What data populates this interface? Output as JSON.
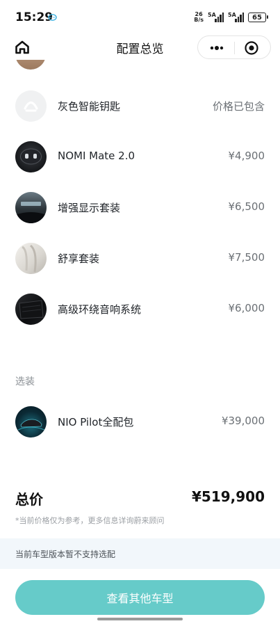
{
  "status_bar": {
    "time": "15:29",
    "net_speed_value": "26",
    "net_speed_unit": "B/s",
    "signal_1_label": "5A",
    "signal_2_label": "5A",
    "battery": "65"
  },
  "nav": {
    "title": "配置总览"
  },
  "items": [
    {
      "name": "灰色智能钥匙",
      "price": "价格已包含",
      "icon": "nio-key-icon"
    },
    {
      "name": "NOMI Mate 2.0",
      "price": "¥4,900",
      "icon": "nomi-mate-icon"
    },
    {
      "name": "增强显示套装",
      "price": "¥6,500",
      "icon": "display-package-icon"
    },
    {
      "name": "舒享套装",
      "price": "¥7,500",
      "icon": "comfort-package-icon"
    },
    {
      "name": "高级环绕音响系统",
      "price": "¥6,000",
      "icon": "audio-system-icon"
    }
  ],
  "optional_section": {
    "label": "选装",
    "items": [
      {
        "name": "NIO Pilot全配包",
        "price": "¥39,000",
        "icon": "nio-pilot-icon"
      }
    ]
  },
  "summary": {
    "total_label": "总价",
    "total_value": "¥519,900",
    "disclaimer": "*当前价格仅为参考，更多信息详询蔚来顾问"
  },
  "notice": "当前车型版本暂不支持选配",
  "cta": {
    "label": "查看其他车型"
  },
  "colors": {
    "accent": "#66cbc9",
    "notice_bg": "#f2f7fb"
  }
}
